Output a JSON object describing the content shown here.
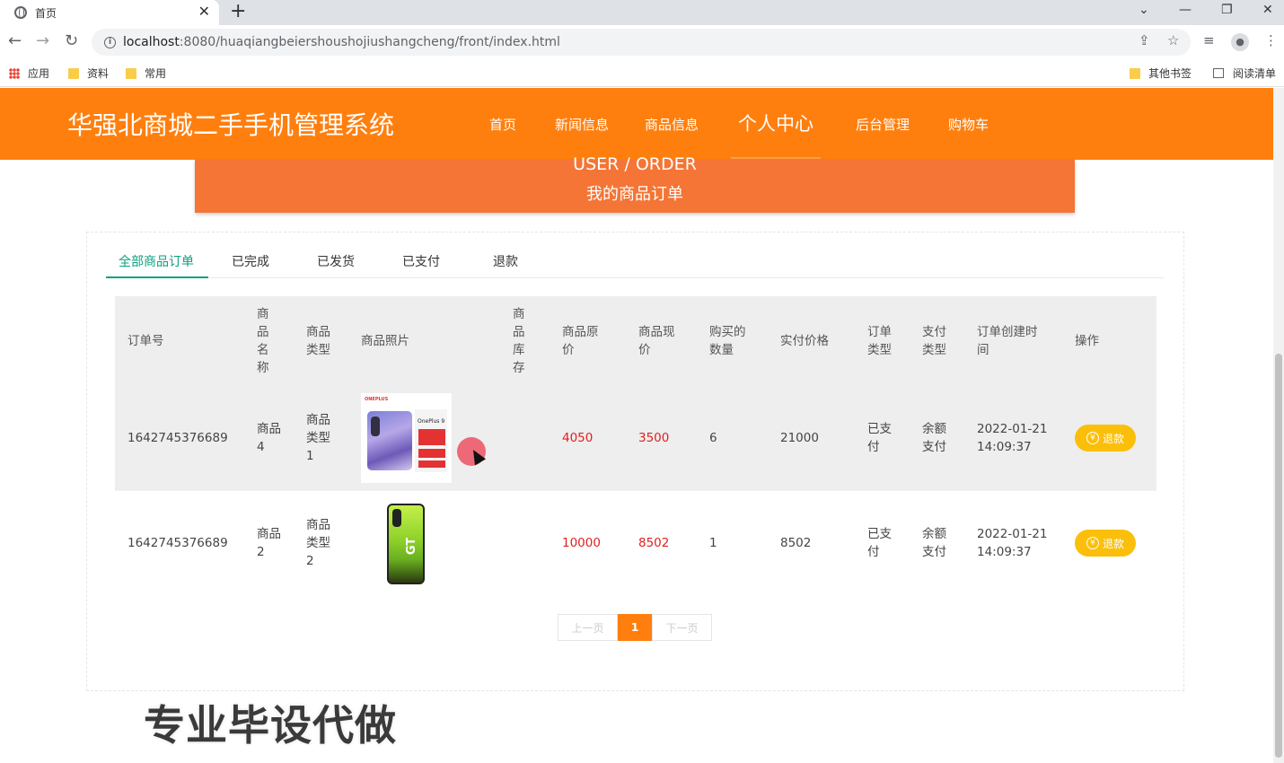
{
  "browser": {
    "tab_title": "首页",
    "url_host": "localhost",
    "url_rest": ":8080/huaqiangbeiershoushojiushangcheng/front/index.html",
    "bookmarks": [
      "应用",
      "资料",
      "常用"
    ],
    "bookmarks_right": [
      "其他书签",
      "阅读清单"
    ]
  },
  "site": {
    "title": "华强北商城二手手机管理系统",
    "nav": [
      "首页",
      "新闻信息",
      "商品信息",
      "个人中心",
      "后台管理",
      "购物车"
    ],
    "active_nav": "个人中心"
  },
  "banner": {
    "en": "USER / ORDER",
    "cn": "我的商品订单"
  },
  "order_tabs": [
    "全部商品订单",
    "已完成",
    "已发货",
    "已支付",
    "退款"
  ],
  "active_tab": "全部商品订单",
  "table": {
    "headers": [
      "订单号",
      "商品名称",
      "商品类型",
      "商品照片",
      "商品库存",
      "商品原价",
      "商品现价",
      "购买的数量",
      "实付价格",
      "订单类型",
      "支付类型",
      "订单创建时间",
      "操作"
    ],
    "rows": [
      {
        "order_no": "1642745376689",
        "name": "商品4",
        "type": "商品类型1",
        "photo": "oneplus-9-phone-photo",
        "stock": "",
        "orig_price": "4050",
        "cur_price": "3500",
        "qty": "6",
        "paid": "21000",
        "order_type": "已支付",
        "pay_type": "余额支付",
        "created": "2022-01-21 14:09:37",
        "action": "退款"
      },
      {
        "order_no": "1642745376689",
        "name": "商品2",
        "type": "商品类型2",
        "photo": "realme-gt-neo2-phone-photo",
        "stock": "",
        "orig_price": "10000",
        "cur_price": "8502",
        "qty": "1",
        "paid": "8502",
        "order_type": "已支付",
        "pay_type": "余额支付",
        "created": "2022-01-21 14:09:37",
        "action": "退款"
      }
    ]
  },
  "pager": {
    "prev": "上一页",
    "current": "1",
    "next": "下一页"
  },
  "watermark": "专业毕设代做",
  "colors": {
    "header": "#ff7f0e",
    "banner": "#f47535",
    "active_tab": "#0b9f80",
    "refund": "#fbbf0a",
    "price": "#e02020"
  }
}
